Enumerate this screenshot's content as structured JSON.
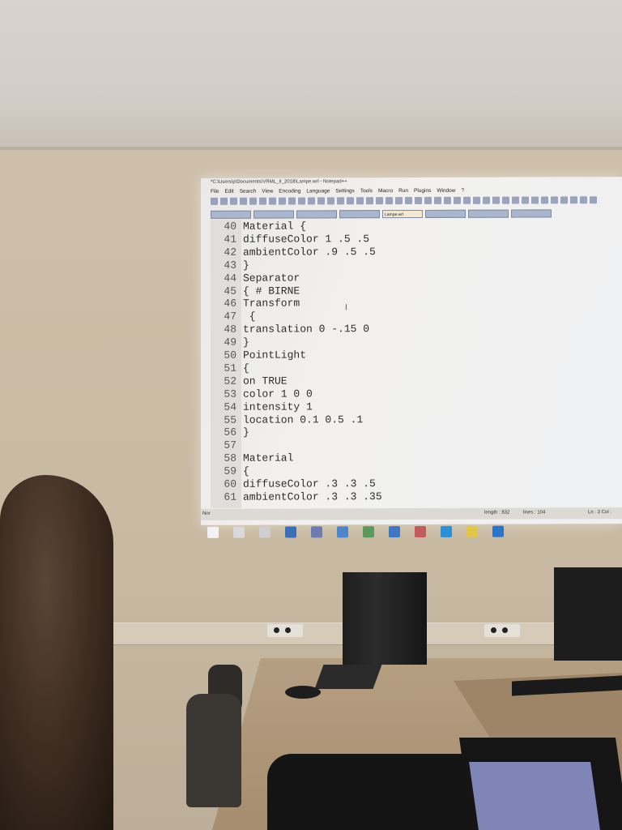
{
  "window_title": "*C:\\Users\\p\\Documents\\VRML_II_2018\\Lampe.wrl - Notepad++",
  "menu": [
    "File",
    "Edit",
    "Search",
    "View",
    "Encoding",
    "Language",
    "Settings",
    "Tools",
    "Macro",
    "Run",
    "Plugins",
    "Window",
    "?"
  ],
  "tabs": [
    "",
    "",
    "",
    "",
    "Lampe.wrl",
    "",
    "",
    ""
  ],
  "active_tab_index": 4,
  "code_lines": [
    {
      "num": "40",
      "text": "Material {"
    },
    {
      "num": "41",
      "text": "diffuseColor 1 .5 .5"
    },
    {
      "num": "42",
      "text": "ambientColor .9 .5 .5"
    },
    {
      "num": "43",
      "text": "}"
    },
    {
      "num": "44",
      "text": "Separator"
    },
    {
      "num": "45",
      "text": "{  # BIRNE"
    },
    {
      "num": "46",
      "text": "Transform"
    },
    {
      "num": "47",
      "text": " {"
    },
    {
      "num": "48",
      "text": "translation 0 -.15 0"
    },
    {
      "num": "49",
      "text": "}"
    },
    {
      "num": "50",
      "text": "PointLight"
    },
    {
      "num": "51",
      "text": "{"
    },
    {
      "num": "52",
      "text": "on TRUE"
    },
    {
      "num": "53",
      "text": "color 1 0 0"
    },
    {
      "num": "54",
      "text": "intensity 1"
    },
    {
      "num": "55",
      "text": "location 0.1 0.5 .1"
    },
    {
      "num": "56",
      "text": "}"
    },
    {
      "num": "57",
      "text": ""
    },
    {
      "num": "58",
      "text": "Material"
    },
    {
      "num": "59",
      "text": "{"
    },
    {
      "num": "60",
      "text": "diffuseColor .3 .3 .5"
    },
    {
      "num": "61",
      "text": "ambientColor .3 .3 .35"
    }
  ],
  "status": {
    "mode": "Nor",
    "length": "length : 832",
    "lines": "lines : 104",
    "position": "Ln : 3   Col :"
  },
  "taskbar_icons": [
    "windows-start-icon",
    "search-icon",
    "task-view-icon",
    "app-icon",
    "app-icon",
    "app-icon",
    "app-icon",
    "app-icon",
    "app-icon",
    "skype-icon",
    "notepad-icon",
    "edge-icon"
  ],
  "colors": {
    "projection_bg": "#eeeeee",
    "code_text": "#2d2d2d",
    "wall": "#c8b9a2"
  }
}
